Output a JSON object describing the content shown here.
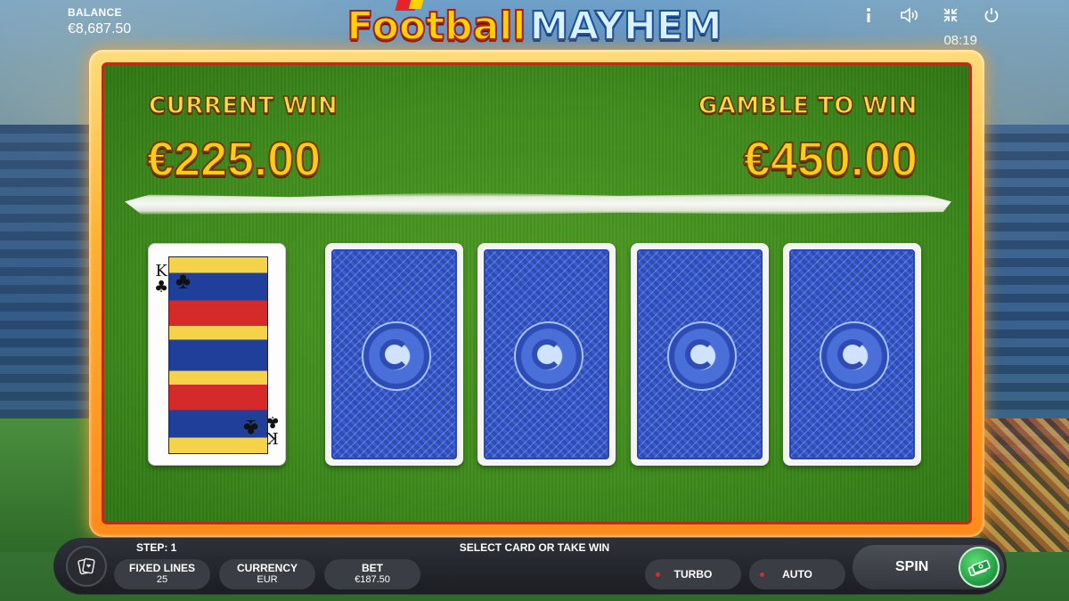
{
  "header": {
    "balance_label": "BALANCE",
    "balance_value": "€8,687.50",
    "logo_part1": "Football",
    "logo_part2": "MAYHEM",
    "clock": "08:19",
    "icons": [
      "info-icon",
      "sound-icon",
      "fullscreen-icon",
      "power-icon"
    ]
  },
  "gamble": {
    "current_win_label": "CURRENT WIN",
    "current_win_value": "€225.00",
    "gamble_to_win_label": "GAMBLE TO WIN",
    "gamble_to_win_value": "€450.00",
    "dealer_card": {
      "rank": "K",
      "suit": "♣"
    },
    "face_down_cards": 4
  },
  "footer": {
    "step_label": "STEP: 1",
    "status_message": "SELECT CARD OR TAKE WIN",
    "fixed_lines_label": "FIXED LINES",
    "fixed_lines_value": "25",
    "currency_label": "CURRENCY",
    "currency_value": "EUR",
    "bet_label": "BET",
    "bet_value": "€187.50",
    "turbo_label": "TURBO",
    "auto_label": "AUTO",
    "spin_label": "SPIN"
  },
  "colors": {
    "felt": "#3e8a1c",
    "frame": "#ffb030",
    "win_text": "#ffcc1a",
    "card_back": "#3355c8",
    "turbo_dot": "#e0252c",
    "auto_dot": "#e0252c",
    "take_win": "#1e9a3e"
  }
}
